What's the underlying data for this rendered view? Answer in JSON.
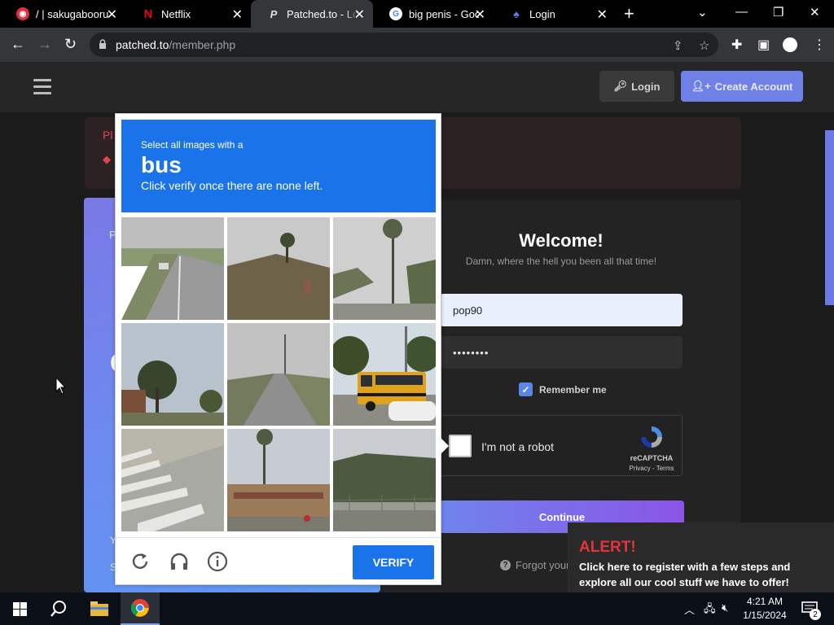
{
  "browser": {
    "tabs": [
      {
        "title": "/ | sakugabooru",
        "favicon": "sakugabooru-icon",
        "active": false
      },
      {
        "title": "Netflix",
        "favicon": "netflix-icon",
        "active": false
      },
      {
        "title": "Patched.to - Log",
        "favicon": "patched-icon",
        "active": true
      },
      {
        "title": "big penis - Goo",
        "favicon": "google-icon",
        "active": false
      },
      {
        "title": "Login",
        "favicon": "login-site-icon",
        "active": false
      }
    ],
    "url_host": "patched.to",
    "url_path": "/member.php"
  },
  "site": {
    "login_button": "Login",
    "create_account_button": "Create Account",
    "alert_title_partial": "Pl",
    "alert_bullet": "◆",
    "side_text_partial": "P",
    "side_big_partial": "C",
    "side_footer_partial_1": "Y",
    "side_footer_partial_2": "S",
    "welcome_title": "Welcome!",
    "welcome_subtitle": "Damn, where the hell you been all that time!",
    "username_value": "pop90",
    "password_value": "••••••••",
    "remember_me": "Remember me",
    "recaptcha_label": "I'm not a robot",
    "recaptcha_brand": "reCAPTCHA",
    "recaptcha_terms": "Privacy - Terms",
    "continue_button": "Continue",
    "forgot_partial": "Forgot your",
    "toast_title": "ALERT!",
    "toast_body": "Click here to register with a few steps and explore all our cool stuff we have to offer!"
  },
  "captcha": {
    "instruction_line1": "Select all images with a",
    "target": "bus",
    "instruction_line3": "Click verify once there are none left.",
    "verify_button": "VERIFY",
    "tiles": [
      {
        "scene": "highway-road"
      },
      {
        "scene": "grassy-hill-palm"
      },
      {
        "scene": "palm-trees-street"
      },
      {
        "scene": "tree-building"
      },
      {
        "scene": "empty-road"
      },
      {
        "scene": "school-bus"
      },
      {
        "scene": "crosswalk"
      },
      {
        "scene": "palm-tree-storefront"
      },
      {
        "scene": "treeline-fence"
      }
    ]
  },
  "taskbar": {
    "time": "4:21 AM",
    "date": "1/15/2024",
    "notification_count": "2"
  },
  "colors": {
    "captcha_blue": "#1a73e8",
    "site_accent": "#6f80e6",
    "toast_red": "#e0353b"
  }
}
